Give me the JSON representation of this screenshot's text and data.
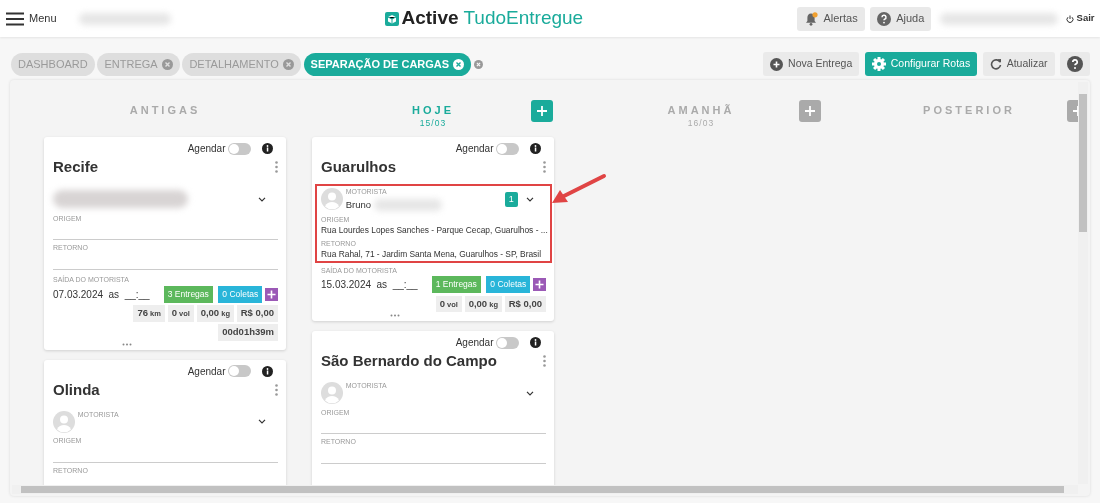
{
  "header": {
    "menu_label": "Menu",
    "logo": {
      "strong": "Active",
      "light": "TudoEntregue"
    },
    "alerts": {
      "label": "Alertas",
      "unread": true
    },
    "help_label": "Ajuda",
    "logout_label": "Sair"
  },
  "tabs": [
    {
      "label": "DASHBOARD",
      "selected": false,
      "closable": false
    },
    {
      "label": "ENTREGA",
      "selected": false,
      "closable": true
    },
    {
      "label": "DETALHAMENTO",
      "selected": false,
      "closable": true
    },
    {
      "label": "SEPARAÇÃO DE CARGAS",
      "selected": true,
      "closable": true
    }
  ],
  "toolbar": [
    {
      "kind": "add",
      "label": "Nova Entrega",
      "primary": false
    },
    {
      "kind": "settings",
      "label": "Configurar Rotas",
      "primary": true
    },
    {
      "kind": "refresh",
      "label": "Atualizar",
      "primary": false
    },
    {
      "kind": "help",
      "primary": false
    }
  ],
  "columns": [
    {
      "title": "ANTIGAS",
      "current": false,
      "cards": [
        {
          "city": "Recife",
          "schedule_label": "Agendar",
          "schedule_on": false,
          "highlighted": false,
          "driver": {
            "kind": "blurred"
          },
          "origin": {
            "label": "ORIGEM"
          },
          "return": {
            "label": "RETORNO"
          },
          "departure": {
            "label": "SAÍDA DO MOTORISTA",
            "date": "07.03.2024",
            "at": "as",
            "time": "__:__"
          },
          "deliveries": "3 Entregas",
          "pickups": "0 Coletas",
          "stats": [
            {
              "value": "76",
              "unit": "km"
            },
            {
              "value": "0",
              "unit": "vol"
            },
            {
              "value": "0,00",
              "unit": "kg"
            },
            {
              "value": "R$ 0,00"
            },
            {
              "value": "00d01h39m"
            }
          ]
        },
        {
          "city": "Olinda",
          "schedule_label": "Agendar",
          "schedule_on": false,
          "highlighted": false,
          "driver": {
            "kind": "empty",
            "label": "MOTORISTA"
          },
          "origin": {
            "label": "ORIGEM"
          },
          "return": {
            "label": "RETORNO"
          }
        }
      ]
    },
    {
      "title": "HOJE",
      "date": "15/03",
      "current": true,
      "add_button": true,
      "cards": [
        {
          "city": "Guarulhos",
          "schedule_label": "Agendar",
          "schedule_on": false,
          "highlighted": true,
          "driver": {
            "kind": "named",
            "label": "MOTORISTA",
            "name": "Bruno",
            "count": "1"
          },
          "origin": {
            "label": "ORIGEM",
            "value": "Rua Lourdes Lopes Sanches - Parque Cecap, Guarulhos - ..."
          },
          "return": {
            "label": "RETORNO",
            "value": "Rua Rahal, 71 - Jardim Santa Mena, Guarulhos - SP, Brasil"
          },
          "departure": {
            "label": "SAÍDA DO MOTORISTA",
            "date": "15.03.2024",
            "at": "as",
            "time": "__:__"
          },
          "deliveries": "1 Entregas",
          "pickups": "0 Coletas",
          "stats": [
            {
              "value": "0",
              "unit": "vol"
            },
            {
              "value": "0,00",
              "unit": "kg"
            },
            {
              "value": "R$ 0,00"
            }
          ]
        },
        {
          "city": "São Bernardo do Campo",
          "schedule_label": "Agendar",
          "schedule_on": false,
          "highlighted": false,
          "driver": {
            "kind": "empty",
            "label": "MOTORISTA"
          },
          "origin": {
            "label": "ORIGEM"
          },
          "return": {
            "label": "RETORNO"
          }
        }
      ]
    },
    {
      "title": "AMANHÃ",
      "date": "16/03",
      "current": false,
      "add_button": true
    },
    {
      "title": "POSTERIOR",
      "current": false,
      "add_button": true
    }
  ]
}
